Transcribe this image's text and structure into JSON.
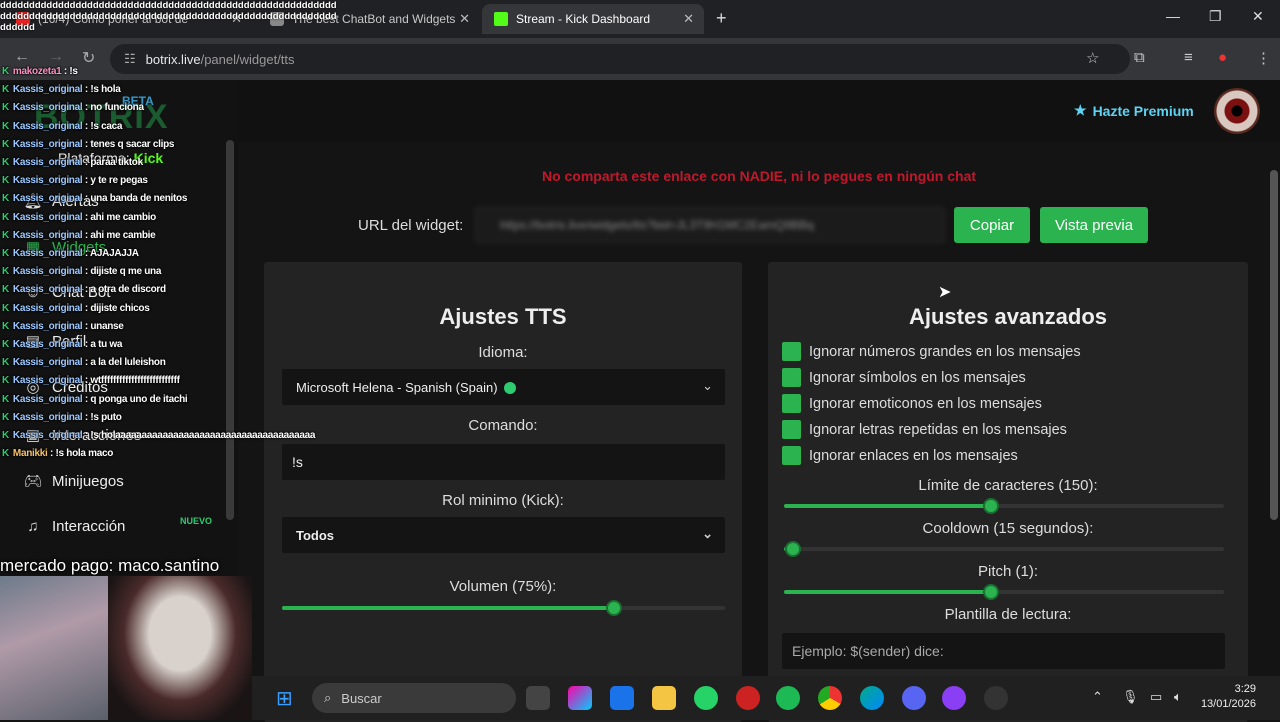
{
  "browser": {
    "tabs": [
      {
        "title": "(16/4) Cómo poner al bot de"
      },
      {
        "title": "The best ChatBot and Widgets"
      },
      {
        "title": "Stream - Kick Dashboard"
      }
    ],
    "url_host": "botrix.live",
    "url_path": "/panel/widget/tts"
  },
  "sidebar": {
    "logo": "BOTRIX",
    "beta": "BETA",
    "platform_label": "Plataforma:",
    "platform_value": "Kick",
    "items": [
      {
        "label": "Alertas"
      },
      {
        "label": "Widgets"
      },
      {
        "label": "Chat Bot"
      },
      {
        "label": "Perfil"
      },
      {
        "label": "Créditos"
      },
      {
        "label": "Interacciones"
      },
      {
        "label": "Minijuegos"
      },
      {
        "label": "Interacción"
      }
    ],
    "nuevo": "NUEVO"
  },
  "header": {
    "premium": "Hazte Premium"
  },
  "widget": {
    "warning": "No comparta este enlace con NADIE, ni lo pegues en ningún chat",
    "url_label": "URL del widget:",
    "url_value": "https://botrix.live/widgets/tts?bid=JL3T9H1MC2EamQ9BBq",
    "copy": "Copiar",
    "preview": "Vista previa"
  },
  "tts": {
    "title": "Ajustes TTS",
    "language_label": "Idioma:",
    "language_value": "Microsoft Helena - Spanish (Spain)",
    "command_label": "Comando:",
    "command_value": "!s",
    "role_label": "Rol minimo (Kick):",
    "role_value": "Todos",
    "volume_label": "Volumen (75%):",
    "volume_fraction": 0.75
  },
  "advanced": {
    "title": "Ajustes avanzados",
    "options": [
      "Ignorar números grandes en los mensajes",
      "Ignorar símbolos en los mensajes",
      "Ignorar emoticonos en los mensajes",
      "Ignorar letras repetidas en los mensajes",
      "Ignorar enlaces en los mensajes"
    ],
    "char_limit_label": "Límite de caracteres (150):",
    "char_limit_fraction": 0.47,
    "cooldown_label": "Cooldown (15 segundos):",
    "cooldown_fraction": 0.02,
    "pitch_label": "Pitch (1):",
    "pitch_fraction": 0.47,
    "template_label": "Plantilla de lectura:",
    "template_placeholder": "Ejemplo: $(sender) dice:"
  },
  "chat_overlay": {
    "spam": "dddddddddddddddddddddddddddddddddddddddddddddddddddddddddddddddddddddddddddddddddddddddddddddddddddddddddddddddddddddddddd",
    "messages": [
      {
        "user": "makozeta1",
        "text": "!s"
      },
      {
        "user": "Kassis_original",
        "text": "!s hola"
      },
      {
        "user": "Kassis_original",
        "text": "no funciona"
      },
      {
        "user": "Kassis_original",
        "text": "!s caca"
      },
      {
        "user": "Kassis_original",
        "text": "tenes q sacar clips"
      },
      {
        "user": "Kassis_original",
        "text": "paraa tiktok"
      },
      {
        "user": "Kassis_original",
        "text": "y te re pegas"
      },
      {
        "user": "Kassis_original",
        "text": "una banda de nenitos"
      },
      {
        "user": "Kassis_original",
        "text": "ahi me cambio"
      },
      {
        "user": "Kassis_original",
        "text": "ahi me cambie"
      },
      {
        "user": "Kassis_original",
        "text": "AJAJAJJA"
      },
      {
        "user": "Kassis_original",
        "text": "dijiste q me una"
      },
      {
        "user": "Kassis_original",
        "text": "a otra de discord"
      },
      {
        "user": "Kassis_original",
        "text": "dijiste chicos"
      },
      {
        "user": "Kassis_original",
        "text": "unanse"
      },
      {
        "user": "Kassis_original",
        "text": "a tu wa"
      },
      {
        "user": "Kassis_original",
        "text": "a la del luleishon"
      },
      {
        "user": "Kassis_original",
        "text": "wtffffffffffffffffffffffffff"
      },
      {
        "user": "Kassis_original",
        "text": "q ponga uno de itachi"
      },
      {
        "user": "Kassis_original",
        "text": "!s puto"
      },
      {
        "user": "Kassis_original",
        "text": "!s holaaaaaaaaaaaaaaaaaaaaaaaaaaaaaaaaaaaaaa"
      },
      {
        "user": "Manikki",
        "text": "!s hola maco"
      }
    ],
    "donation": "mercado pago: maco.santino"
  },
  "taskbar": {
    "search_placeholder": "Buscar",
    "time": "3:29",
    "date": "13/01/2026"
  }
}
